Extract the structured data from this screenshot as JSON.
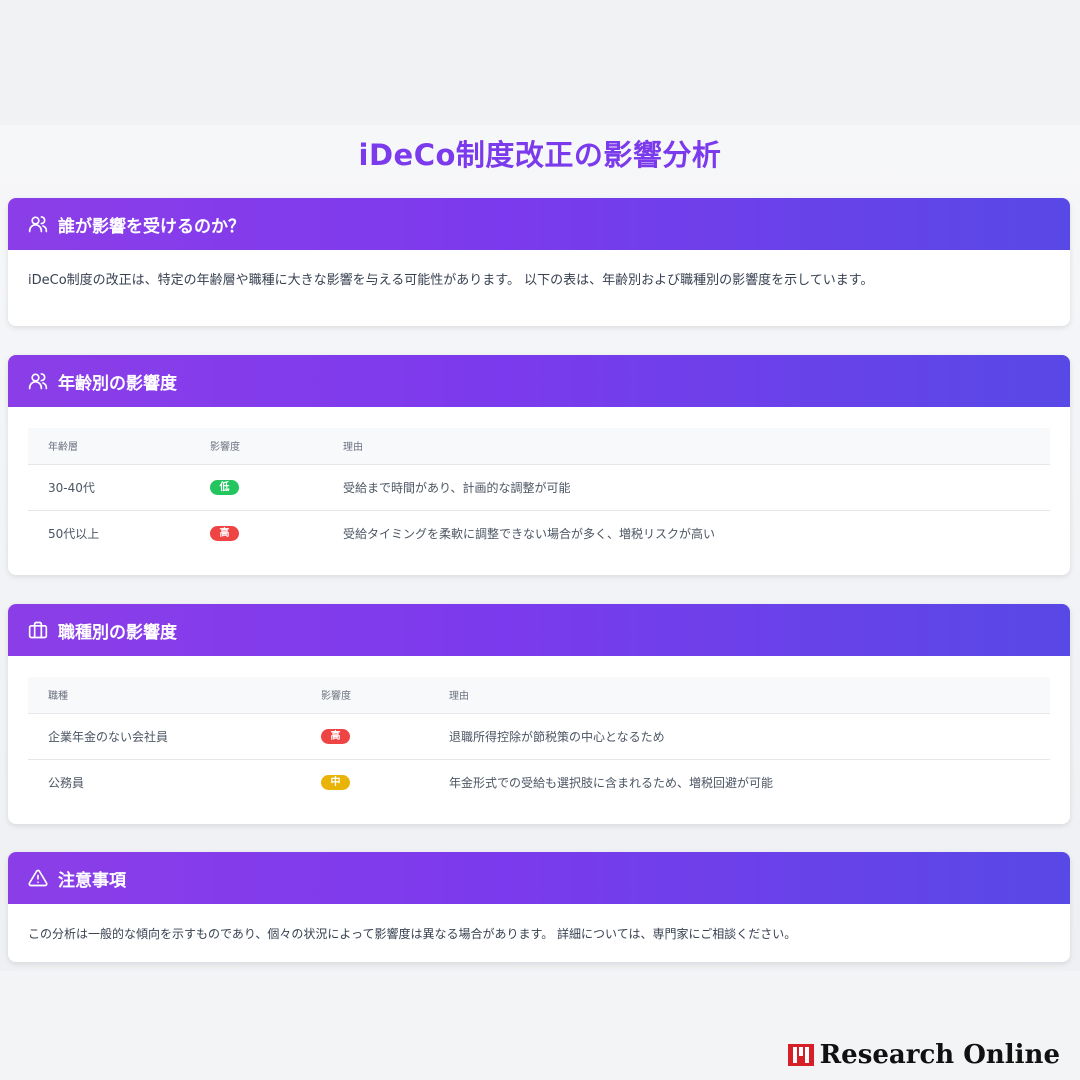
{
  "page": {
    "title": "iDeCo制度改正の影響分析"
  },
  "sections": {
    "who": {
      "icon": "users-icon",
      "title": "誰が影響を受けるのか？",
      "text": "iDeCo制度の改正は、特定の年齢層や職種に大きな影響を与える可能性があります。 以下の表は、年齢別および職種別の影響度を示しています。"
    },
    "age": {
      "icon": "users-icon",
      "title": "年齢別の影響度",
      "headers": [
        "年齢層",
        "影響度",
        "理由"
      ],
      "rows": [
        {
          "group": "30-40代",
          "impact": "低",
          "level": "low",
          "reason": "受給まで時間があり、計画的な調整が可能"
        },
        {
          "group": "50代以上",
          "impact": "高",
          "level": "high",
          "reason": "受給タイミングを柔軟に調整できない場合が多く、増税リスクが高い"
        }
      ]
    },
    "job": {
      "icon": "briefcase-icon",
      "title": "職種別の影響度",
      "headers": [
        "職種",
        "影響度",
        "理由"
      ],
      "rows": [
        {
          "group": "企業年金のない会社員",
          "impact": "高",
          "level": "high",
          "reason": "退職所得控除が節税策の中心となるため"
        },
        {
          "group": "公務員",
          "impact": "中",
          "level": "mid",
          "reason": "年金形式での受給も選択肢に含まれるため、増税回避が可能"
        }
      ]
    },
    "notice": {
      "icon": "warning-icon",
      "title": "注意事項",
      "text": "この分析は一般的な傾向を示すものであり、個々の状況によって影響度は異なる場合があります。 詳細については、専門家にご相談ください。"
    }
  },
  "colors": {
    "accent": "#7c3aed",
    "header_gradient_start": "#8b3ee8",
    "header_gradient_end": "#5848e6",
    "low": "#22c55e",
    "mid": "#eab308",
    "high": "#ef4444"
  },
  "branding": {
    "logo_text": "Research Online",
    "logo_icon": "research-online-logo-mark"
  }
}
